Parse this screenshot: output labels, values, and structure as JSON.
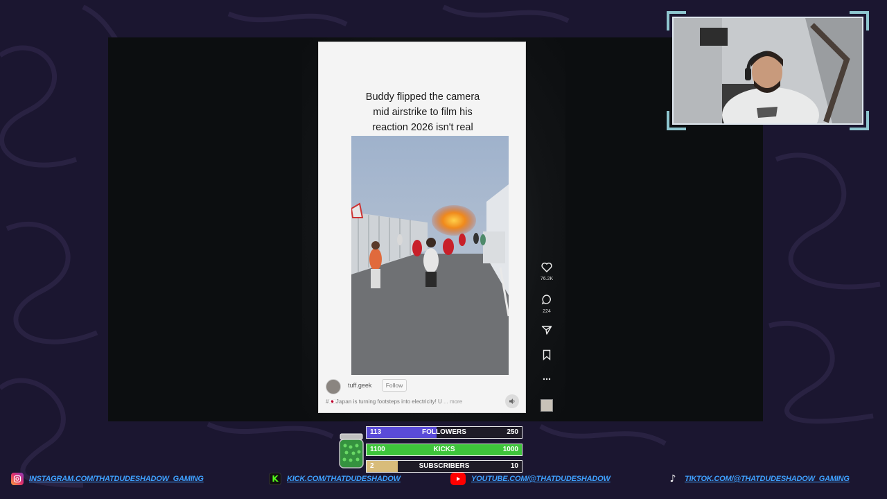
{
  "post": {
    "caption_lines": [
      "Buddy flipped the camera",
      "mid airstrike to film his",
      "reaction 2026 isn't real"
    ],
    "username": "tuff.geek",
    "follow_label": "Follow",
    "description_tag": "#🇯🇵Japan",
    "description": " is turning footsteps into electricity! U",
    "more_label": "... more",
    "likes": "76.2K",
    "comments": "224"
  },
  "stream_stats": {
    "followers": {
      "label": "FOLLOWERS",
      "current": "113",
      "goal": "250",
      "progress": 0.45,
      "color": "#5a4bd8"
    },
    "kicks": {
      "label": "KICKS",
      "current": "1100",
      "goal": "1000",
      "progress": 1.0,
      "color": "#3ec43b"
    },
    "subscribers": {
      "label": "SUBSCRIBERS",
      "current": "2",
      "goal": "10",
      "progress": 0.2,
      "color": "#d8bc7a"
    }
  },
  "socials": [
    {
      "icon": "instagram-icon",
      "text": "INSTAGRAM.COM/THATDUDESHADOW_GAMING",
      "color": "#e1306c"
    },
    {
      "icon": "kick-icon",
      "text": "KICK.COM/THATDUDESHADOW",
      "color": "#53fc18"
    },
    {
      "icon": "youtube-icon",
      "text": "YOUTUBE.COM/@THATDUDESHADOW",
      "color": "#ff0000"
    },
    {
      "icon": "tiktok-icon",
      "text": "TIKTOK.COM/@THATDUDESHADOW_GAMING",
      "color": "#111111"
    }
  ],
  "colors": {
    "background": "#1c1730",
    "swirl": "#2a2244",
    "link": "#3fa1ff",
    "webcam_border": "#8ec6cf"
  }
}
